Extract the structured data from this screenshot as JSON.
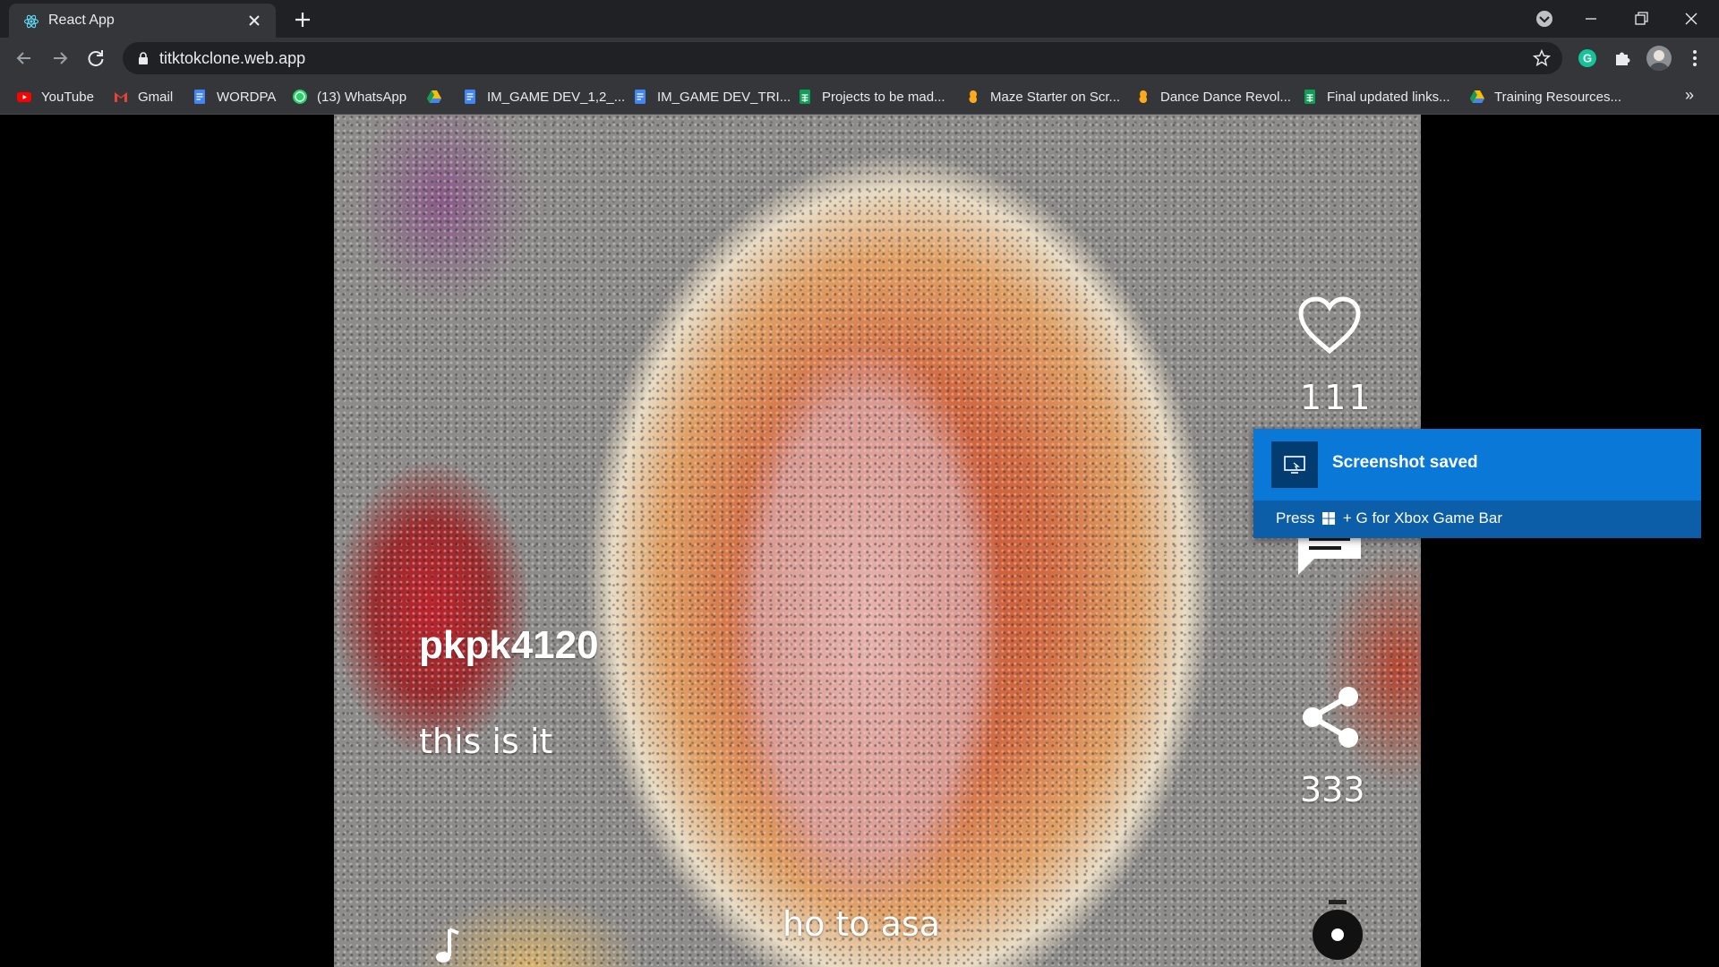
{
  "browser": {
    "tab_title": "React App",
    "url": "titktokclone.web.app",
    "bookmarks": [
      {
        "label": "YouTube",
        "icon": "youtube-icon",
        "color": "#ff0000"
      },
      {
        "label": "Gmail",
        "icon": "gmail-icon",
        "color": "#ea4335"
      },
      {
        "label": "WORDPA",
        "icon": "docs-icon",
        "color": "#4285f4"
      },
      {
        "label": "(13) WhatsApp",
        "icon": "whatsapp-icon",
        "color": "#25d366"
      },
      {
        "label": "",
        "icon": "drive-icon",
        "color": "#fbbc04"
      },
      {
        "label": "IM_GAME DEV_1,2_...",
        "icon": "docs-icon",
        "color": "#4285f4"
      },
      {
        "label": "IM_GAME DEV_TRI...",
        "icon": "docs-icon",
        "color": "#4285f4"
      },
      {
        "label": "Projects to be mad...",
        "icon": "sheets-icon",
        "color": "#0f9d58"
      },
      {
        "label": "Maze Starter on Scr...",
        "icon": "scratch-icon",
        "color": "#ffab19"
      },
      {
        "label": "Dance Dance Revol...",
        "icon": "scratch-icon",
        "color": "#ffab19"
      },
      {
        "label": "Final updated links...",
        "icon": "sheets-icon",
        "color": "#0f9d58"
      },
      {
        "label": "Training Resources...",
        "icon": "drive-icon",
        "color": "#fbbc04"
      }
    ],
    "more_label": "»"
  },
  "video": {
    "username": "pkpk4120",
    "caption": "this is it",
    "song": "ho to asa",
    "likes": "111",
    "shares": "333"
  },
  "toast": {
    "title": "Screenshot saved",
    "hint_before": "Press ",
    "hint_after": " + G for Xbox Game Bar"
  }
}
